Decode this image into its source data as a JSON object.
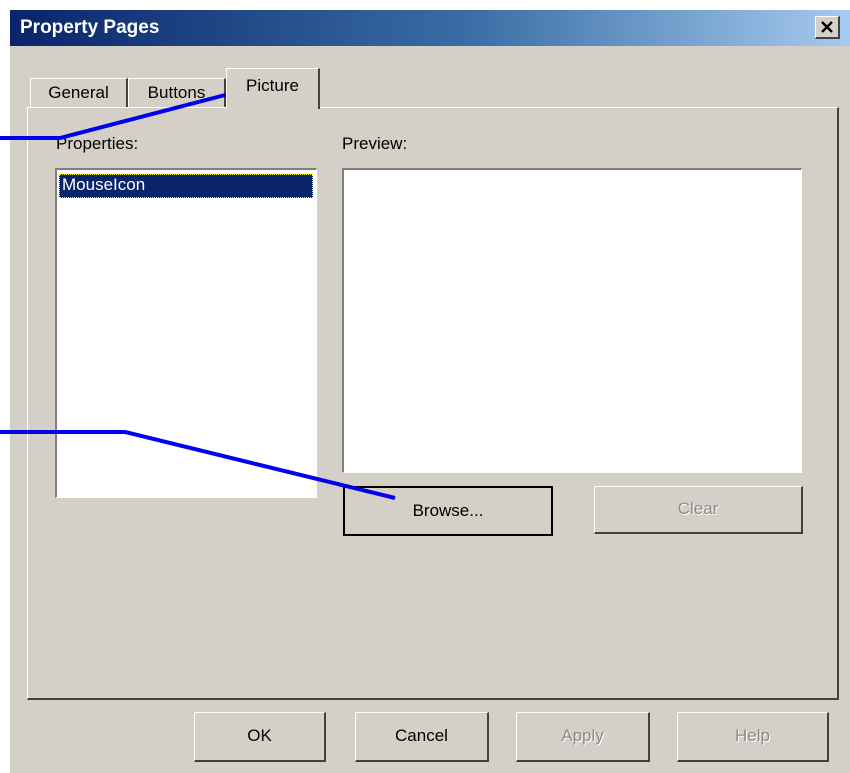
{
  "window": {
    "title": "Property Pages",
    "close_glyph": "✕"
  },
  "tabs": [
    {
      "label": "General",
      "selected": false
    },
    {
      "label": "Buttons",
      "selected": false
    },
    {
      "label": "Picture",
      "selected": true
    }
  ],
  "picture_tab": {
    "properties_label": "Properties:",
    "properties_items": [
      "MouseIcon"
    ],
    "selected_item": "MouseIcon",
    "preview_label": "Preview:",
    "browse_label": "Browse...",
    "clear_label": "Clear"
  },
  "footer": {
    "ok_label": "OK",
    "cancel_label": "Cancel",
    "apply_label": "Apply",
    "help_label": "Help"
  },
  "colors": {
    "titlebar_start": "#0a246a",
    "titlebar_end": "#a6caf0",
    "dialog_bg": "#d4d0c8",
    "selection_bg": "#0a246a",
    "callout_line": "#0000ee"
  }
}
